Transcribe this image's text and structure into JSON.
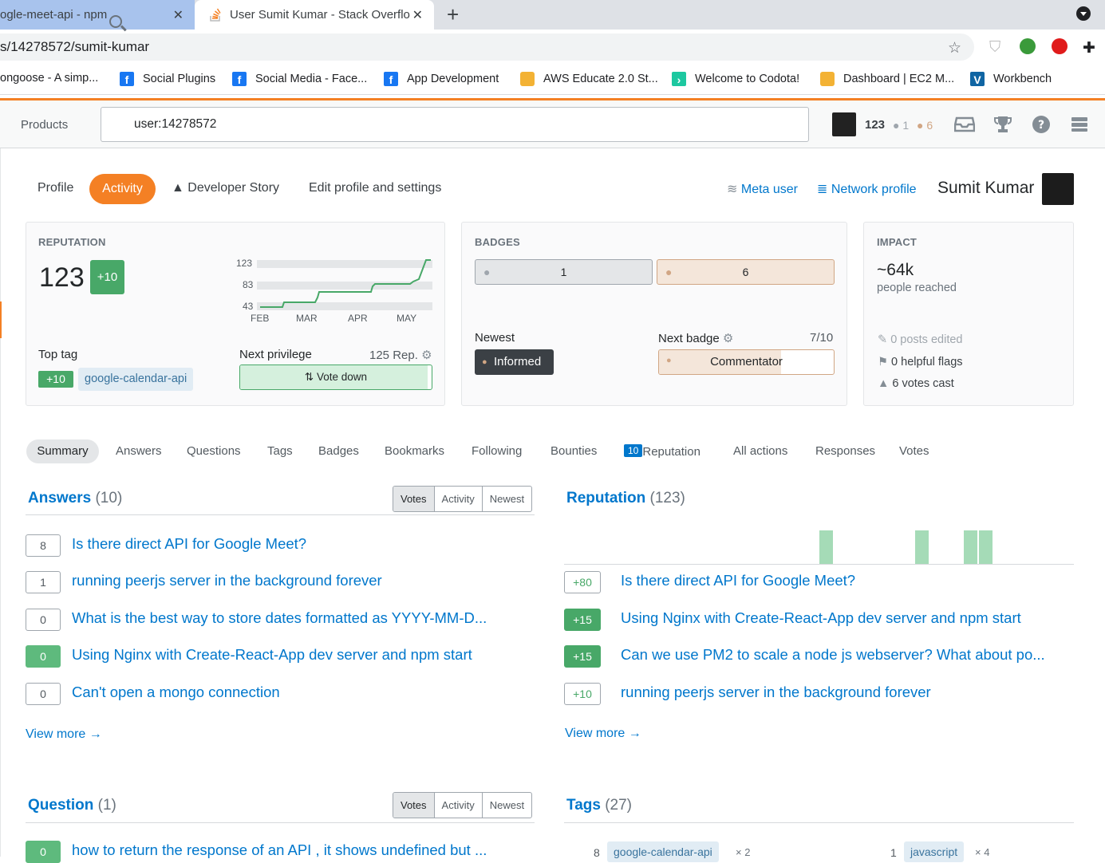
{
  "browser": {
    "tabs": [
      {
        "title": "ogle-meet-api - npm"
      },
      {
        "title": "User Sumit Kumar - Stack Overflo"
      }
    ],
    "url": "s/14278572/sumit-kumar",
    "bookmarks": [
      "ongoose - A simp...",
      "Social Plugins",
      "Social Media - Face...",
      "App Development",
      "AWS Educate 2.0 St...",
      "Welcome to Codota!",
      "Dashboard | EC2 M...",
      "Workbench"
    ]
  },
  "header": {
    "products": "Products",
    "search_value": "user:14278572",
    "rep": "123",
    "silver": "1",
    "bronze": "6"
  },
  "profile_nav": {
    "profile": "Profile",
    "activity": "Activity",
    "developer_story": "Developer Story",
    "edit": "Edit profile and settings",
    "meta_user": "Meta user",
    "network_profile": "Network profile",
    "user_name": "Sumit Kumar"
  },
  "reputation": {
    "title": "REPUTATION",
    "value": "123",
    "change": "+10",
    "graph_y": [
      "123",
      "83",
      "43"
    ],
    "graph_x": [
      "FEB",
      "MAR",
      "APR",
      "MAY"
    ],
    "top_tag_label": "Top tag",
    "top_tag_score": "+10",
    "top_tag": "google-calendar-api",
    "next_privilege_label": "Next privilege",
    "next_privilege_rep": "125 Rep.",
    "next_privilege": "Vote down",
    "progress": 0.98
  },
  "badges": {
    "title": "BADGES",
    "silver": "1",
    "bronze": "6",
    "newest_label": "Newest",
    "newest": "Informed",
    "next_label": "Next badge",
    "next_progress": "7/10",
    "next": "Commentator"
  },
  "impact": {
    "title": "IMPACT",
    "reach": "~64k",
    "reach_label": "people reached",
    "edits": "0 posts edited",
    "flags": "0 helpful flags",
    "votes": "6 votes cast"
  },
  "subtabs": {
    "summary": "Summary",
    "answers": "Answers",
    "questions": "Questions",
    "tags": "Tags",
    "badges": "Badges",
    "bookmarks": "Bookmarks",
    "following": "Following",
    "bounties": "Bounties",
    "rep_count": "10",
    "reputation": "Reputation",
    "all_actions": "All actions",
    "responses": "Responses",
    "votes": "Votes"
  },
  "answers": {
    "title": "Answers",
    "count": "(10)",
    "sort": [
      "Votes",
      "Activity",
      "Newest"
    ],
    "items": [
      {
        "score": "8",
        "title": "Is there direct API for Google Meet?"
      },
      {
        "score": "1",
        "title": "running peerjs server in the background forever"
      },
      {
        "score": "0",
        "title": "What is the best way to store dates formatted as YYYY-MM-D..."
      },
      {
        "score": "0",
        "title": "Using Nginx with Create-React-App dev server and npm start"
      },
      {
        "score": "0",
        "title": "Can't open a mongo connection"
      }
    ],
    "view_more": "View more →"
  },
  "rep_section": {
    "title": "Reputation",
    "count": "(123)",
    "items": [
      {
        "score": "+80",
        "title": "Is there direct API for Google Meet?"
      },
      {
        "score": "+15",
        "title": "Using Nginx with Create-React-App dev server and npm start"
      },
      {
        "score": "+15",
        "title": "Can we use PM2 to scale a node js webserver? What about po..."
      },
      {
        "score": "+10",
        "title": "running peerjs server in the background forever"
      }
    ],
    "view_more": "View more →"
  },
  "questions": {
    "title": "Question",
    "count": "(1)",
    "sort": [
      "Votes",
      "Activity",
      "Newest"
    ],
    "items": [
      {
        "score": "0",
        "title": "how to return the response of an API , it shows undefined but ..."
      }
    ]
  },
  "tags": {
    "title": "Tags",
    "count": "(27)",
    "items": [
      {
        "count": "8",
        "name": "google-calendar-api",
        "mult": "× 2"
      },
      {
        "count": "1",
        "name": "javascript",
        "mult": "× 4"
      }
    ]
  }
}
